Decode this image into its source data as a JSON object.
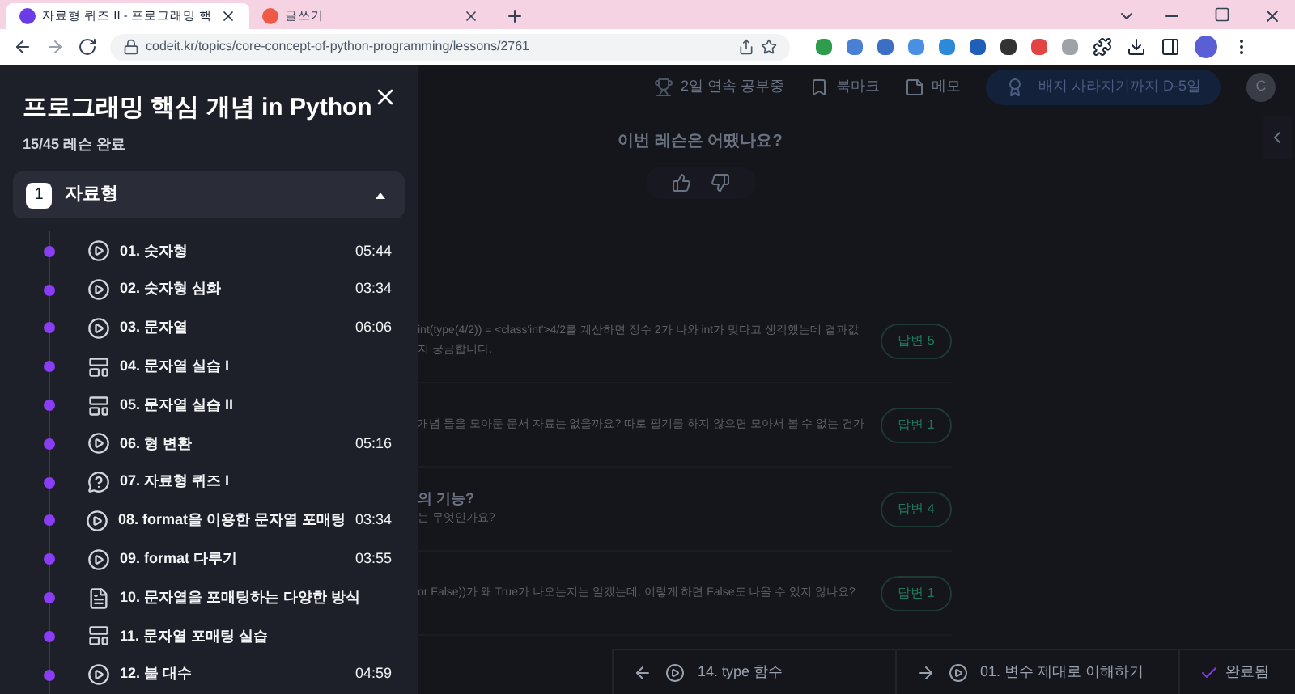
{
  "browser": {
    "tabs": [
      {
        "title": "자료형 퀴즈 II - 프로그래밍 핵",
        "selected": true
      },
      {
        "title": "글쓰기",
        "selected": false
      }
    ],
    "url": "codeit.kr/topics/core-concept-of-python-programming/lessons/2761"
  },
  "top_nav": {
    "streak": "2일 연속 공부중",
    "bookmark": "북마크",
    "memo": "메모",
    "badge": "배지 사라지기까지 D-5일",
    "avatar": "C"
  },
  "sidebar": {
    "title": "프로그래밍 핵심 개념 in Python",
    "progress": "15/45 레슨 완료",
    "section": {
      "number": "1",
      "title": "자료형",
      "expanded": true
    },
    "lessons": [
      {
        "kind": "video",
        "label": "01. 숫자형",
        "duration": "05:44",
        "completed": true
      },
      {
        "kind": "video",
        "label": "02. 숫자형 심화",
        "duration": "03:34",
        "completed": true
      },
      {
        "kind": "video",
        "label": "03. 문자열",
        "duration": "06:06",
        "completed": true
      },
      {
        "kind": "practice",
        "label": "04. 문자열 실습 I",
        "completed": true
      },
      {
        "kind": "practice",
        "label": "05. 문자열 실습 II",
        "completed": true
      },
      {
        "kind": "video",
        "label": "06. 형 변환",
        "duration": "05:16",
        "completed": true
      },
      {
        "kind": "quiz",
        "label": "07. 자료형 퀴즈 I",
        "completed": true
      },
      {
        "kind": "video",
        "label": "08. format을 이용한 문자열 포매팅",
        "duration": "03:34",
        "completed": true
      },
      {
        "kind": "video",
        "label": "09. format 다루기",
        "duration": "03:55",
        "completed": true
      },
      {
        "kind": "note",
        "label": "10. 문자열을 포매팅하는 다양한 방식",
        "completed": true
      },
      {
        "kind": "practice",
        "label": "11. 문자열 포매팅 실습",
        "completed": true
      },
      {
        "kind": "video",
        "label": "12. 불 대수",
        "duration": "04:59",
        "completed": true
      }
    ]
  },
  "feedback": {
    "question": "이번 레슨은 어땠나요?"
  },
  "questions": [
    {
      "lines": [
        "int(type(4/2)) = <class'int'>4/2를 계산하면 정수 2가 나와 int가 맞다고 생각했는데 결과값",
        "지 궁금합니다."
      ],
      "answers": "답변 5"
    },
    {
      "lines": [
        "개념 들을 모아둔 문서 자료는 없을까요? 따로 필기를 하지 않으면 모아서 볼 수 없는 건가"
      ],
      "answers": "답변 1"
    },
    {
      "title": "의 기능?",
      "lines": [
        "는 무엇인가요?"
      ],
      "answers": "답변 4"
    },
    {
      "lines": [
        "or False))가 왜 True가 나오는지는 알겠는데, 이렇게 하면 False도 나올 수 있지 않나요?"
      ],
      "answers": "답변 1"
    }
  ],
  "bottom_bar": {
    "prev": "14. type 함수",
    "next": "01. 변수 제대로 이해하기",
    "complete": {
      "label": "완료됨",
      "checked": true
    }
  }
}
